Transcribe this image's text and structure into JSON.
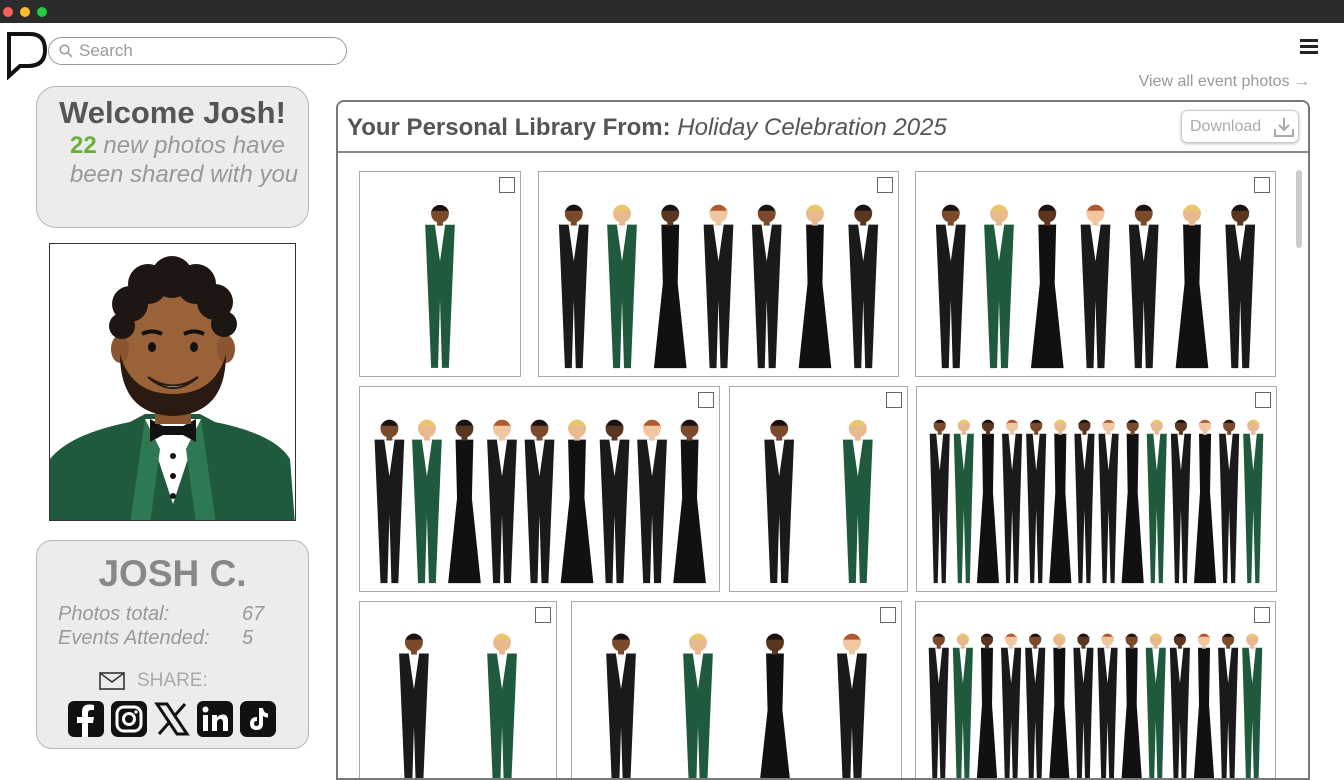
{
  "search": {
    "placeholder": "Search"
  },
  "header": {
    "view_all": "View all event photos →"
  },
  "welcome": {
    "title": "Welcome Josh!",
    "count": "22",
    "message": "new photos have been shared with you"
  },
  "profile": {
    "name": "JOSH C.",
    "stats": [
      {
        "label": "Photos total:",
        "value": "67"
      },
      {
        "label": "Events Attended:",
        "value": "5"
      }
    ],
    "share_label": "SHARE:",
    "socials": [
      "facebook-icon",
      "instagram-icon",
      "x-icon",
      "linkedin-icon",
      "tiktok-icon"
    ]
  },
  "library": {
    "title_prefix": "Your Personal Library From:",
    "event_name": "Holiday Celebration 2025",
    "download_label": "Download"
  },
  "colors": {
    "accent_green": "#6cae3c",
    "tux_green": "#1f5a3c"
  },
  "photos": [
    {
      "people": 1,
      "checked": false
    },
    {
      "people": 7,
      "checked": false
    },
    {
      "people": 7,
      "checked": false
    },
    {
      "people": 9,
      "checked": false
    },
    {
      "people": 2,
      "checked": false
    },
    {
      "people": 14,
      "checked": false
    },
    {
      "people": 2,
      "checked": false
    },
    {
      "people": 4,
      "checked": false
    },
    {
      "people": 14,
      "checked": false
    }
  ]
}
